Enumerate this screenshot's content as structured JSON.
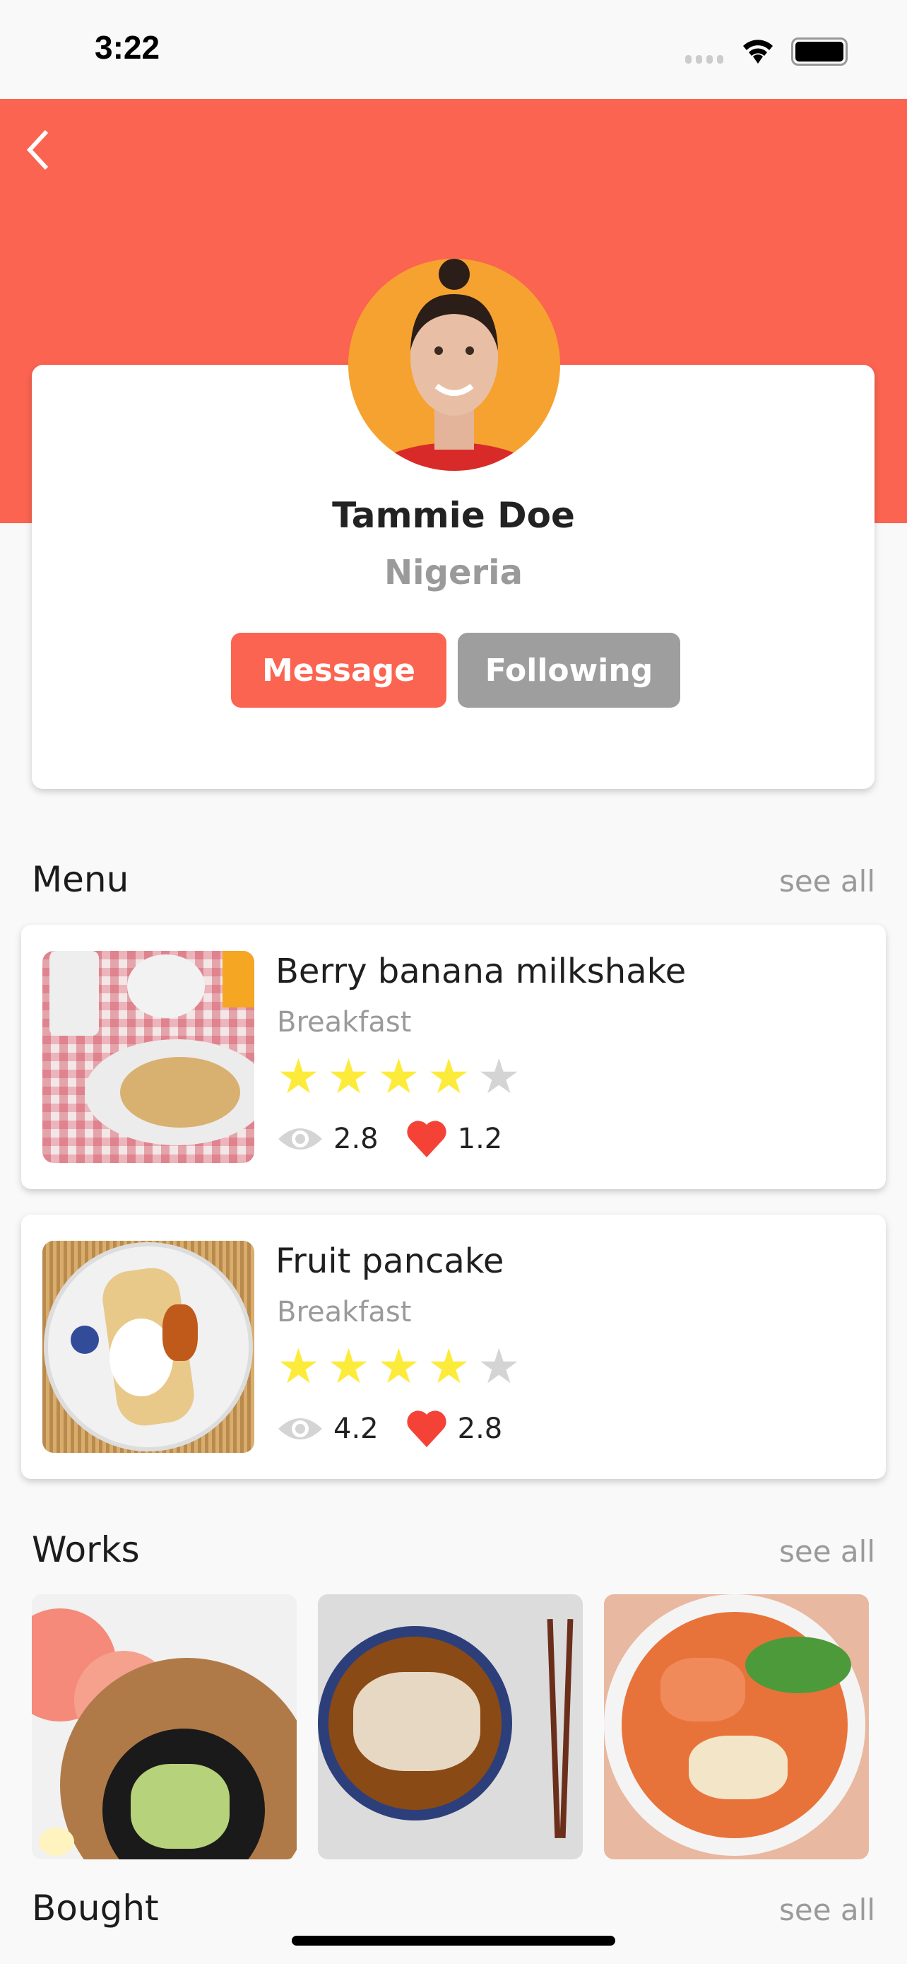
{
  "status_bar": {
    "time": "3:22"
  },
  "colors": {
    "accent": "#fb6450",
    "muted_button": "#9e9e9e",
    "star_on": "#fdeb3b",
    "star_off": "#d4d4d4",
    "heart": "#f44336",
    "eye": "#d4d4d4"
  },
  "profile": {
    "name": "Tammie Doe",
    "country": "Nigeria",
    "message_label": "Message",
    "following_label": "Following"
  },
  "menu": {
    "title": "Menu",
    "see_all": "see all",
    "items": [
      {
        "title": "Berry banana milkshake",
        "category": "Breakfast",
        "rating": 4,
        "max_rating": 5,
        "views": "2.8",
        "likes": "1.2"
      },
      {
        "title": "Fruit pancake",
        "category": "Breakfast",
        "rating": 4,
        "max_rating": 5,
        "views": "4.2",
        "likes": "2.8"
      }
    ]
  },
  "works": {
    "title": "Works",
    "see_all": "see all"
  },
  "bought": {
    "title": "Bought",
    "see_all": "see all"
  }
}
